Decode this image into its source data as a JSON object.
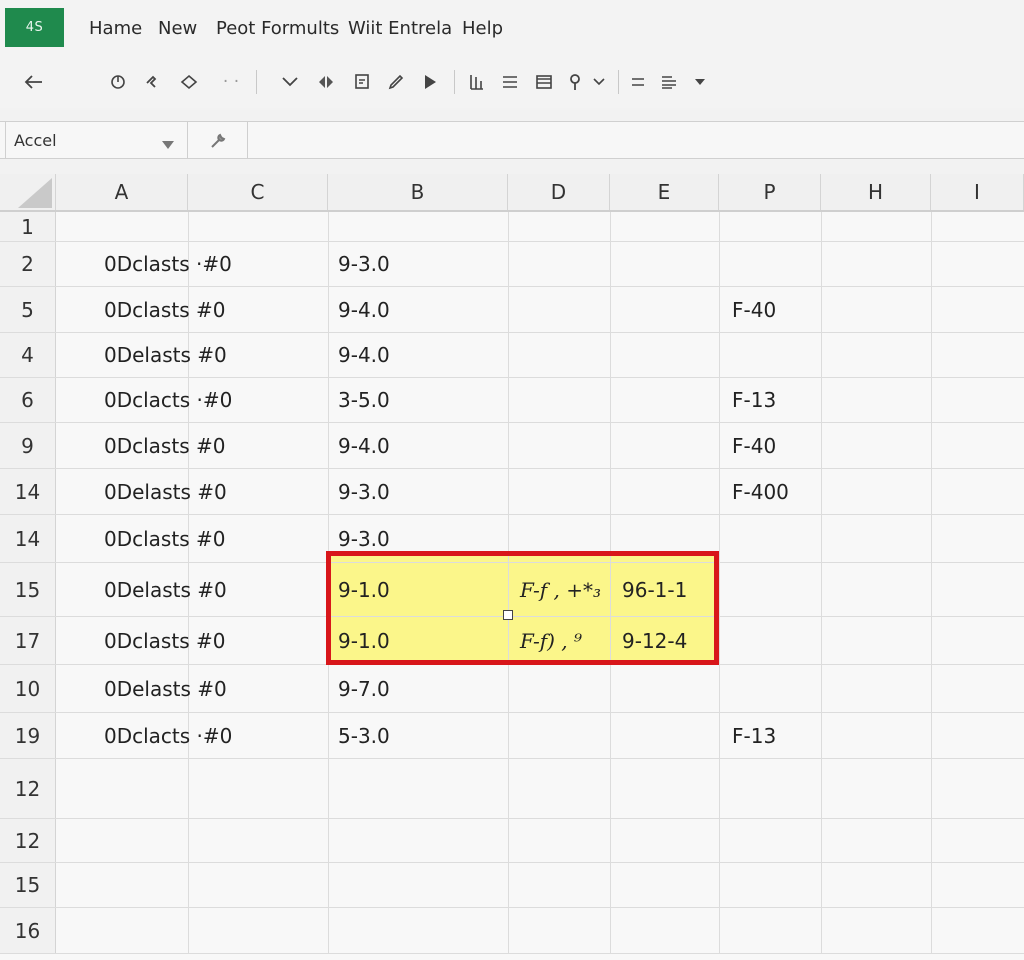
{
  "app": {
    "badge": "4S"
  },
  "menu": [
    "Hame",
    "New",
    "Peot Formults",
    "Wiit Entrela",
    "Help"
  ],
  "toolbar": {
    "icons": [
      "back-arrow-icon",
      "refresh-icon",
      "cursor-icon",
      "diamond-icon",
      "dots-icon",
      "chevron-down-icon",
      "split-icon",
      "sheet-icon",
      "pen-icon",
      "play-icon",
      "columns-icon",
      "align-icon",
      "table-icon",
      "pin-icon",
      "dropdown-icon",
      "equals-icon",
      "align-right-icon",
      "dropdown-icon"
    ]
  },
  "namebox": {
    "value": "Accel"
  },
  "columns": [
    "A",
    "C",
    "B",
    "D",
    "E",
    "P",
    "H",
    "I"
  ],
  "rows": [
    {
      "num": "1",
      "a": "",
      "b": "",
      "d": "",
      "e": "",
      "p": ""
    },
    {
      "num": "2",
      "a": "0Dclasts ·#0",
      "b": "9-3.0",
      "d": "",
      "e": "",
      "p": ""
    },
    {
      "num": "5",
      "a": "0Dclasts #0",
      "b": "9-4.0",
      "d": "",
      "e": "",
      "p": "F-40"
    },
    {
      "num": "4",
      "a": "0Delasts #0",
      "b": "9-4.0",
      "d": "",
      "e": "",
      "p": ""
    },
    {
      "num": "6",
      "a": "0Dclacts ·#0",
      "b": "3-5.0",
      "d": "",
      "e": "",
      "p": "F-13"
    },
    {
      "num": "9",
      "a": "0Dclasts #0",
      "b": "9-4.0",
      "d": "",
      "e": "",
      "p": "F-40"
    },
    {
      "num": "14",
      "a": "0Delasts #0",
      "b": "9-3.0",
      "d": "",
      "e": "",
      "p": "F-400"
    },
    {
      "num": "14",
      "a": "0Dclasts #0",
      "b": "9-3.0",
      "d": "",
      "e": "",
      "p": ""
    },
    {
      "num": "15",
      "a": "0Delasts #0",
      "b": "9-1.0",
      "d": "F-f , +*₃",
      "e": "96-1-1",
      "p": ""
    },
    {
      "num": "17",
      "a": "0Dclasts #0",
      "b": "9-1.0",
      "d": "F-f) , ⁹",
      "e": "9-12-4",
      "p": ""
    },
    {
      "num": "10",
      "a": "0Delasts #0",
      "b": "9-7.0",
      "d": "",
      "e": "",
      "p": ""
    },
    {
      "num": "19",
      "a": "0Dclacts ·#0",
      "b": "5-3.0",
      "d": "",
      "e": "",
      "p": "F-13"
    },
    {
      "num": "12",
      "a": "",
      "b": "",
      "d": "",
      "e": "",
      "p": ""
    },
    {
      "num": "12",
      "a": "",
      "b": "",
      "d": "",
      "e": "",
      "p": ""
    },
    {
      "num": "15",
      "a": "",
      "b": "",
      "d": "",
      "e": "",
      "p": ""
    },
    {
      "num": "16",
      "a": "",
      "b": "",
      "d": "",
      "e": "",
      "p": ""
    }
  ],
  "colors": {
    "badge": "#1f8a4d",
    "highlight_fill": "#fbf68a",
    "highlight_border": "#d8161a"
  }
}
